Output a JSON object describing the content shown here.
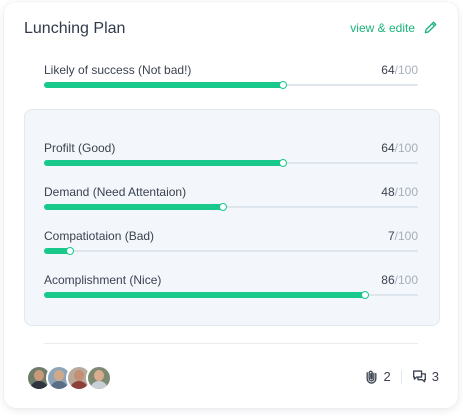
{
  "card": {
    "title": "Lunching Plan",
    "view_edit_label": "view & edite",
    "accent_color": "#18c98b"
  },
  "success": {
    "label": "Likely of success (Not bad!)",
    "value": 64,
    "value_text": "64",
    "total_text": "/100"
  },
  "metrics": [
    {
      "label": "Profilt (Good)",
      "value": 64,
      "value_text": "64",
      "total_text": "/100"
    },
    {
      "label": "Demand (Need Attentaion)",
      "value": 48,
      "value_text": "48",
      "total_text": "/100"
    },
    {
      "label": "Compatiotaion (Bad)",
      "value": 7,
      "value_text": "7",
      "total_text": "/100"
    },
    {
      "label": "Acomplishment (Nice)",
      "value": 86,
      "value_text": "86",
      "total_text": "/100"
    }
  ],
  "footer": {
    "attachments_count": "2",
    "comments_count": "3",
    "attachment_icon": "paperclip-icon",
    "comment_icon": "comments-icon"
  }
}
